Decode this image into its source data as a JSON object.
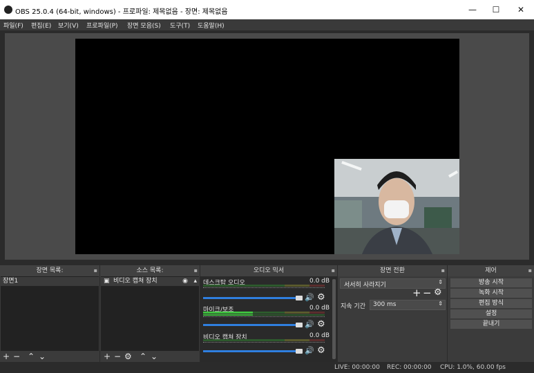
{
  "window": {
    "title": "OBS 25.0.4 (64-bit, windows) - 프로파일: 제목없음 - 장면: 제목없음",
    "minimize": "—",
    "maximize": "☐",
    "close": "✕"
  },
  "menu": [
    "파일(F)",
    "편집(E)",
    "보기(V)",
    "프로파일(P)",
    "장면 모음(S)",
    "도구(T)",
    "도움말(H)"
  ],
  "scenes": {
    "header": "장면 목록:",
    "items": [
      "장면1"
    ]
  },
  "sources": {
    "header": "소스 목록:",
    "items": [
      "비디오 캡쳐 장치"
    ]
  },
  "mixer": {
    "header": "오디오 믹서",
    "channels": [
      {
        "name": "데스크탑 오디오",
        "db": "0.0 dB",
        "level": 0.0,
        "volume": 1.0
      },
      {
        "name": "마이크/보조",
        "db": "0.0 dB",
        "level": 0.4,
        "volume": 1.0
      },
      {
        "name": "비디오 캡쳐 장치",
        "db": "0.0 dB",
        "level": 0.0,
        "volume": 1.0
      }
    ]
  },
  "transitions": {
    "header": "장면 전환",
    "selected": "서서히 사라지기",
    "duration_label": "지속 기간",
    "duration_value": "300 ms"
  },
  "controls": {
    "header": "제어",
    "buttons": [
      "방송 시작",
      "녹화 시작",
      "편집 방식",
      "설정",
      "끝내기"
    ]
  },
  "status": {
    "live": "LIVE: 00:00:00",
    "rec": "REC: 00:00:00",
    "cpu": "CPU: 1.0%, 60.00 fps"
  },
  "colors": {
    "accent": "#2f7fe0",
    "meter_green": "#3fbf3f",
    "meter_yellow": "#c8c83a",
    "meter_red": "#c83a3a"
  }
}
